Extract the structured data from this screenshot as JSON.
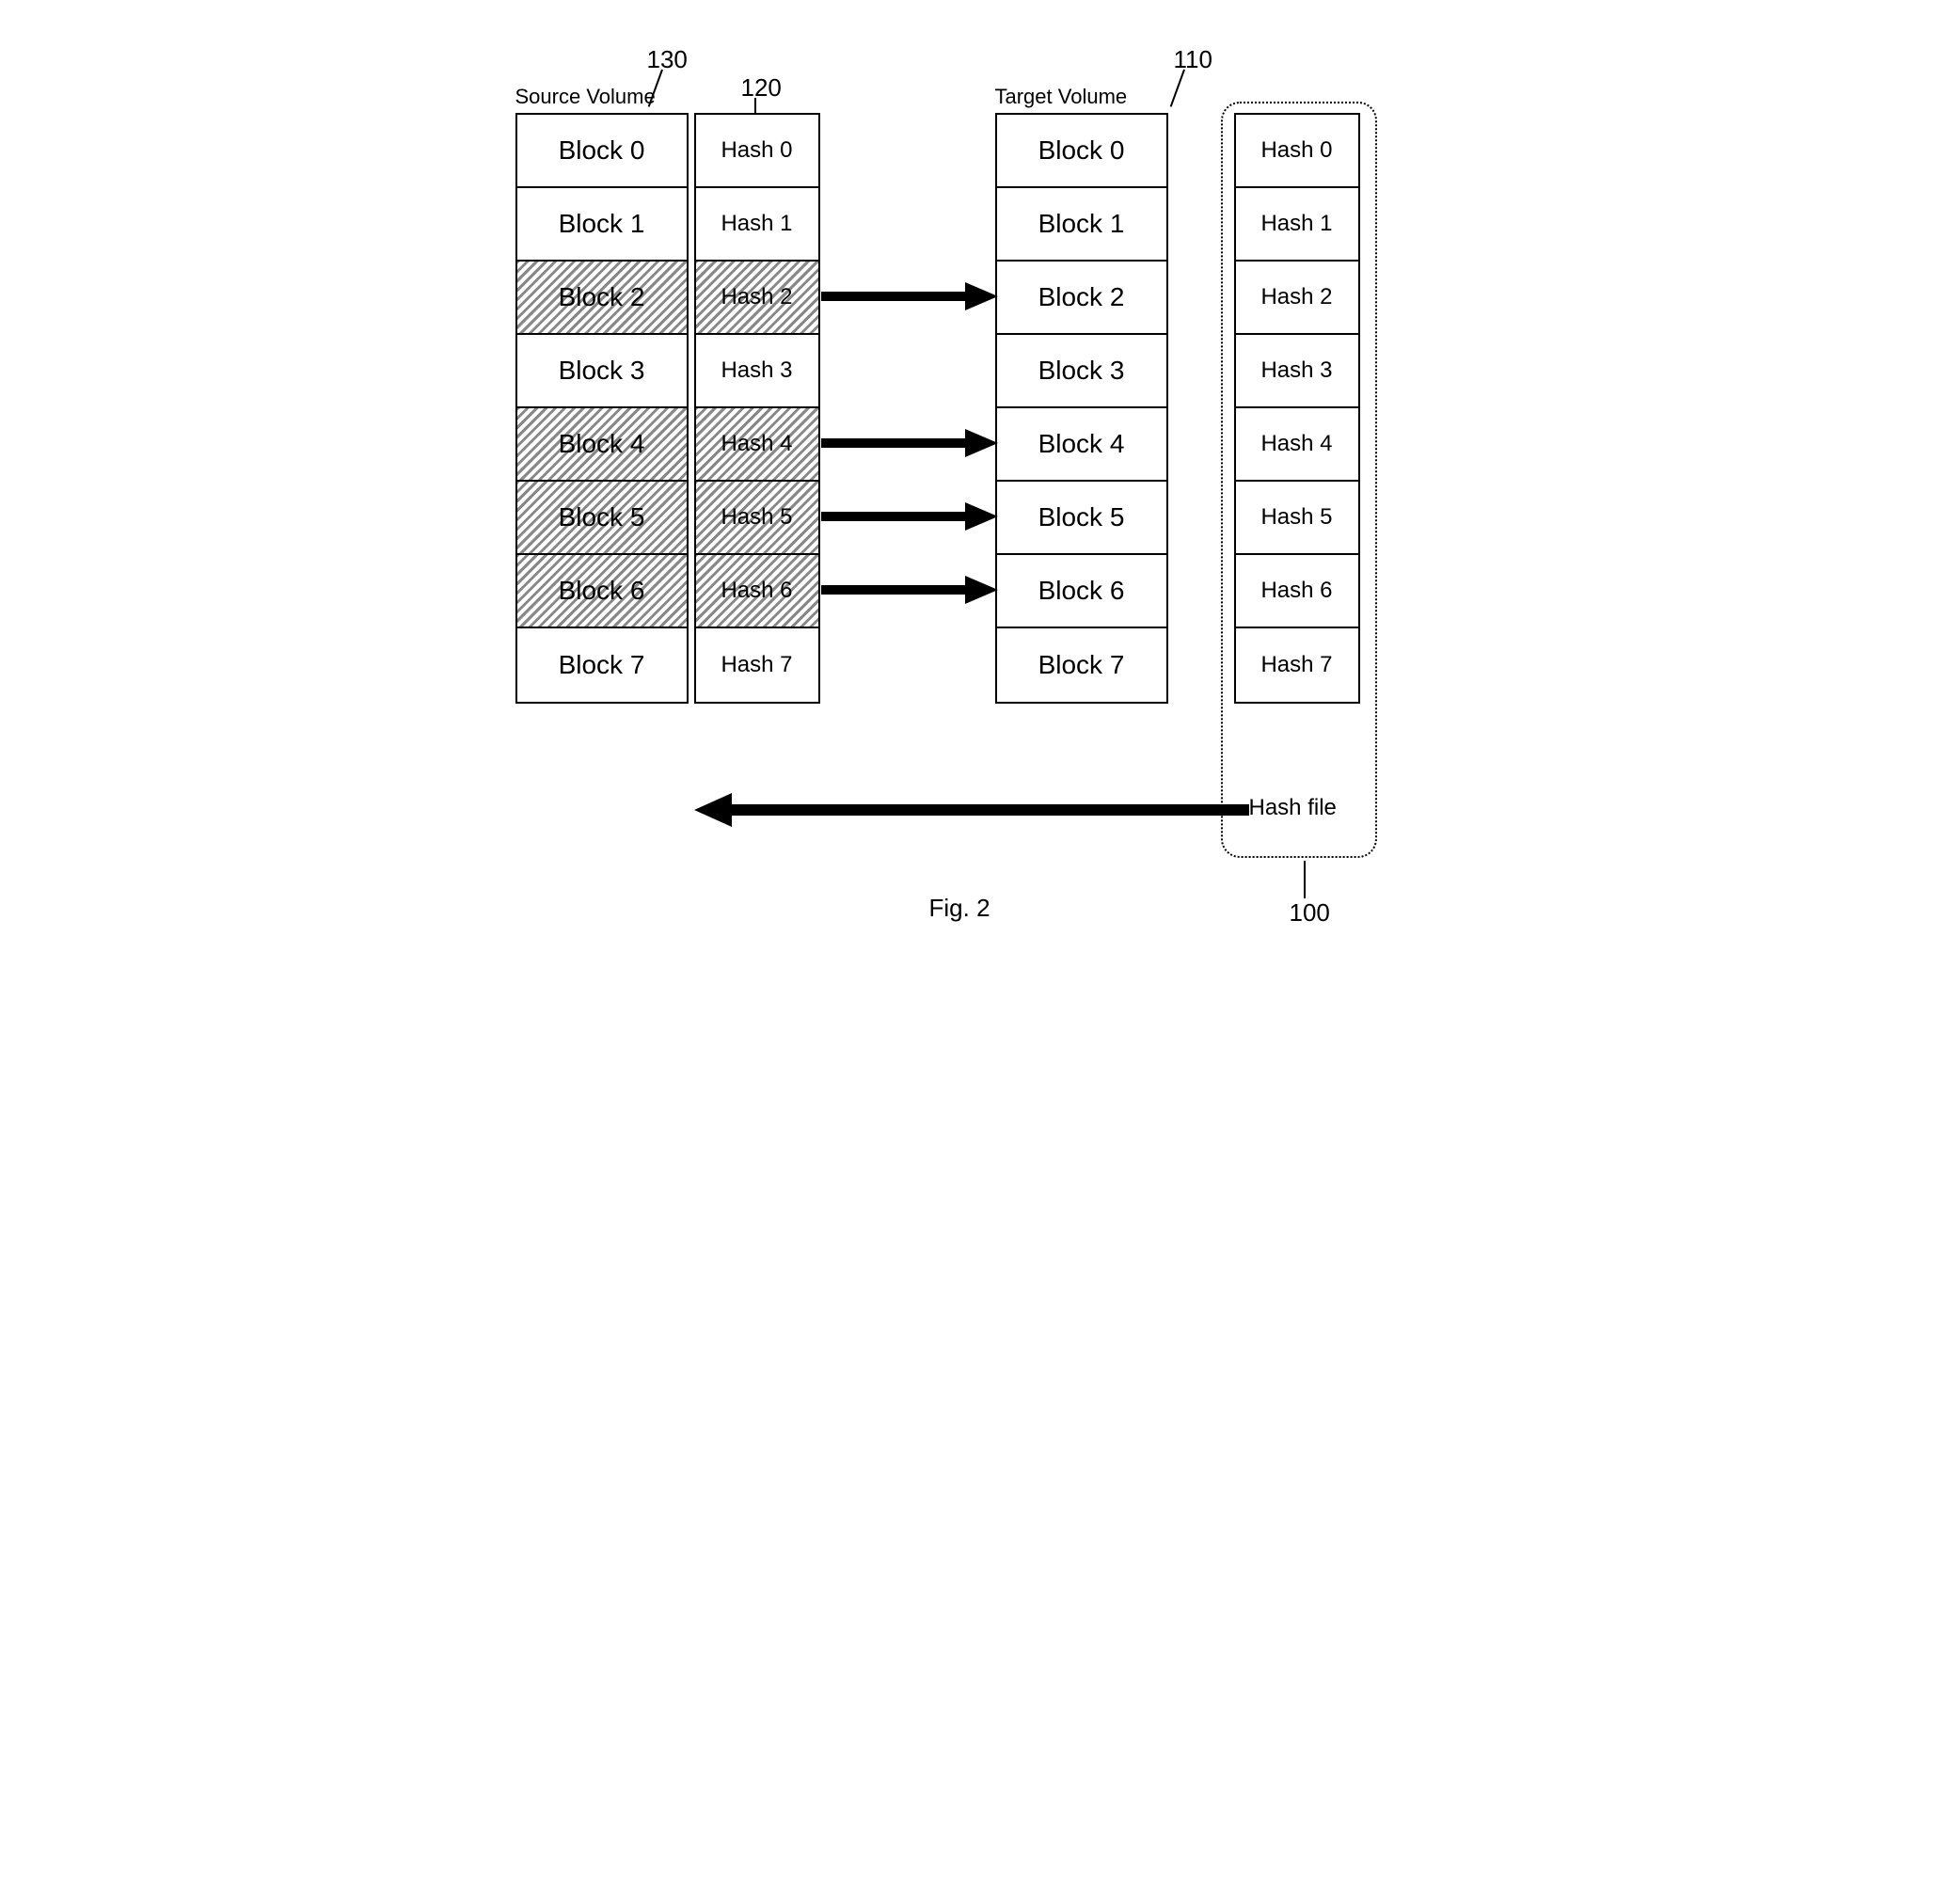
{
  "labels": {
    "source": "Source Volume",
    "target": "Target Volume",
    "figure": "Fig. 2"
  },
  "refs": {
    "r130": "130",
    "r120": "120",
    "r110": "110",
    "r100": "100"
  },
  "sourceBlocks": [
    "Block 0",
    "Block 1",
    "Block 2",
    "Block 3",
    "Block 4",
    "Block 5",
    "Block 6",
    "Block 7"
  ],
  "sourceHashes": [
    "Hash 0",
    "Hash 1",
    "Hash 2",
    "Hash 3",
    "Hash 4",
    "Hash 5",
    "Hash 6",
    "Hash 7"
  ],
  "targetBlocks": [
    "Block 0",
    "Block 1",
    "Block 2",
    "Block 3",
    "Block 4",
    "Block 5",
    "Block 6",
    "Block 7"
  ],
  "targetHashes": [
    "Hash 0",
    "Hash 1",
    "Hash 2",
    "Hash 3",
    "Hash 4",
    "Hash 5",
    "Hash 6",
    "Hash 7"
  ],
  "hashFileLabel": "Hash file"
}
